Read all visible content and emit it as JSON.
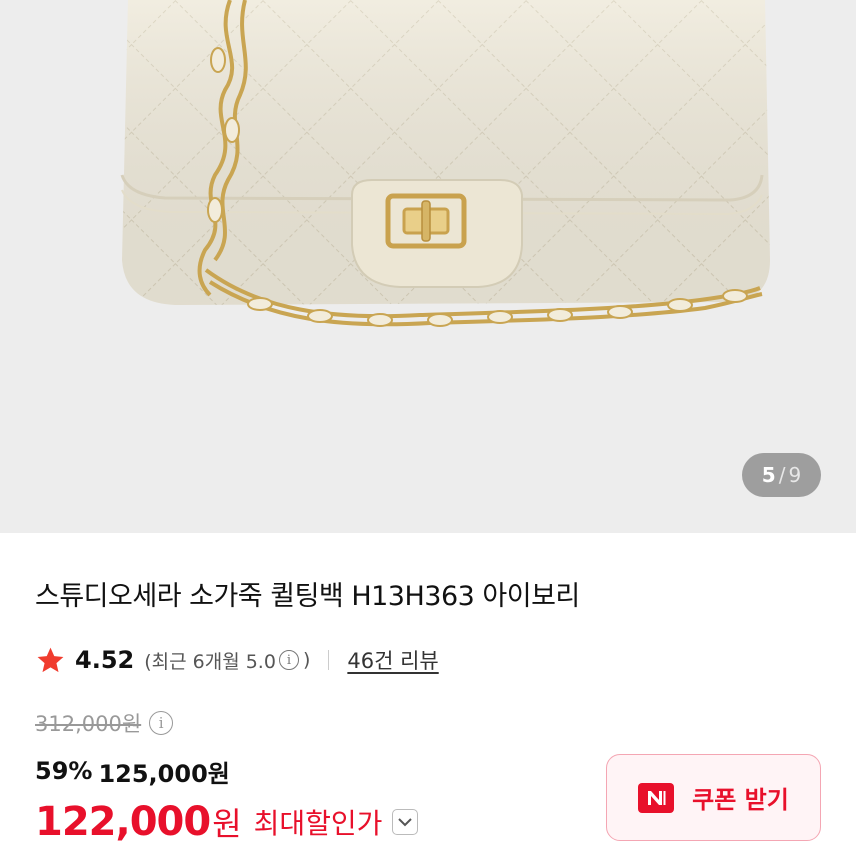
{
  "gallery": {
    "current": "5",
    "separator": "/",
    "total": "9"
  },
  "product": {
    "title": "스튜디오세라 소가죽 퀼팅백 H13H363 아이보리"
  },
  "rating": {
    "score": "4.52",
    "recent_prefix": "(최근 6개월 5.0",
    "recent_suffix": ")",
    "review_link": "46건 리뷰",
    "star_color": "#f03c2e"
  },
  "price": {
    "original": "312,000원",
    "discount_percent": "59%",
    "sale_price": "125,000원",
    "final_price": "122,000",
    "final_unit": "원",
    "final_label": "최대할인가"
  },
  "coupon": {
    "label": "쿠폰 받기",
    "icon": "coupon-n-icon",
    "accent_color": "#e8102b"
  },
  "icons": {
    "info": "i"
  }
}
